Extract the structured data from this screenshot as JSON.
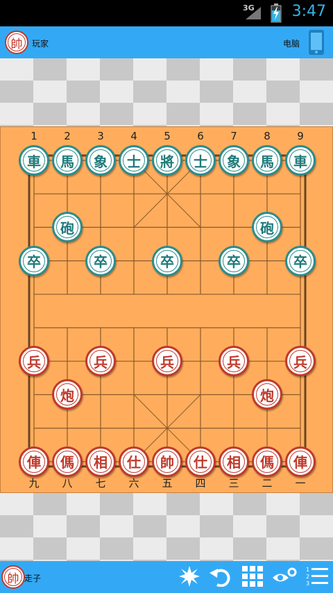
{
  "status_bar": {
    "network": "3G",
    "time": "3:47"
  },
  "top_bar": {
    "player_label": "玩家",
    "player_avatar": "帥",
    "computer_label": "电脑",
    "computer_icon": "phone-icon"
  },
  "board": {
    "top_coords": [
      "1",
      "2",
      "3",
      "4",
      "5",
      "6",
      "7",
      "8",
      "9"
    ],
    "bottom_coords": [
      "九",
      "八",
      "七",
      "六",
      "五",
      "四",
      "三",
      "二",
      "一"
    ],
    "black_pieces": [
      {
        "ch": "車",
        "file": 0,
        "rank": 0
      },
      {
        "ch": "馬",
        "file": 1,
        "rank": 0
      },
      {
        "ch": "象",
        "file": 2,
        "rank": 0
      },
      {
        "ch": "士",
        "file": 3,
        "rank": 0
      },
      {
        "ch": "將",
        "file": 4,
        "rank": 0
      },
      {
        "ch": "士",
        "file": 5,
        "rank": 0
      },
      {
        "ch": "象",
        "file": 6,
        "rank": 0
      },
      {
        "ch": "馬",
        "file": 7,
        "rank": 0
      },
      {
        "ch": "車",
        "file": 8,
        "rank": 0
      },
      {
        "ch": "砲",
        "file": 1,
        "rank": 2
      },
      {
        "ch": "砲",
        "file": 7,
        "rank": 2
      },
      {
        "ch": "卒",
        "file": 0,
        "rank": 3
      },
      {
        "ch": "卒",
        "file": 2,
        "rank": 3
      },
      {
        "ch": "卒",
        "file": 4,
        "rank": 3
      },
      {
        "ch": "卒",
        "file": 6,
        "rank": 3
      },
      {
        "ch": "卒",
        "file": 8,
        "rank": 3
      }
    ],
    "red_pieces": [
      {
        "ch": "兵",
        "file": 0,
        "rank": 6
      },
      {
        "ch": "兵",
        "file": 2,
        "rank": 6
      },
      {
        "ch": "兵",
        "file": 4,
        "rank": 6
      },
      {
        "ch": "兵",
        "file": 6,
        "rank": 6
      },
      {
        "ch": "兵",
        "file": 8,
        "rank": 6
      },
      {
        "ch": "炮",
        "file": 1,
        "rank": 7
      },
      {
        "ch": "炮",
        "file": 7,
        "rank": 7
      },
      {
        "ch": "俥",
        "file": 0,
        "rank": 9
      },
      {
        "ch": "傌",
        "file": 1,
        "rank": 9
      },
      {
        "ch": "相",
        "file": 2,
        "rank": 9
      },
      {
        "ch": "仕",
        "file": 3,
        "rank": 9
      },
      {
        "ch": "帥",
        "file": 4,
        "rank": 9
      },
      {
        "ch": "仕",
        "file": 5,
        "rank": 9
      },
      {
        "ch": "相",
        "file": 6,
        "rank": 9
      },
      {
        "ch": "傌",
        "file": 7,
        "rank": 9
      },
      {
        "ch": "俥",
        "file": 8,
        "rank": 9
      }
    ]
  },
  "bottom_bar": {
    "avatar": "帥",
    "turn_label": "走子",
    "icons": [
      "burst-icon",
      "undo-icon",
      "grid-icon",
      "view-settings-icon",
      "menu-list-icon"
    ]
  }
}
